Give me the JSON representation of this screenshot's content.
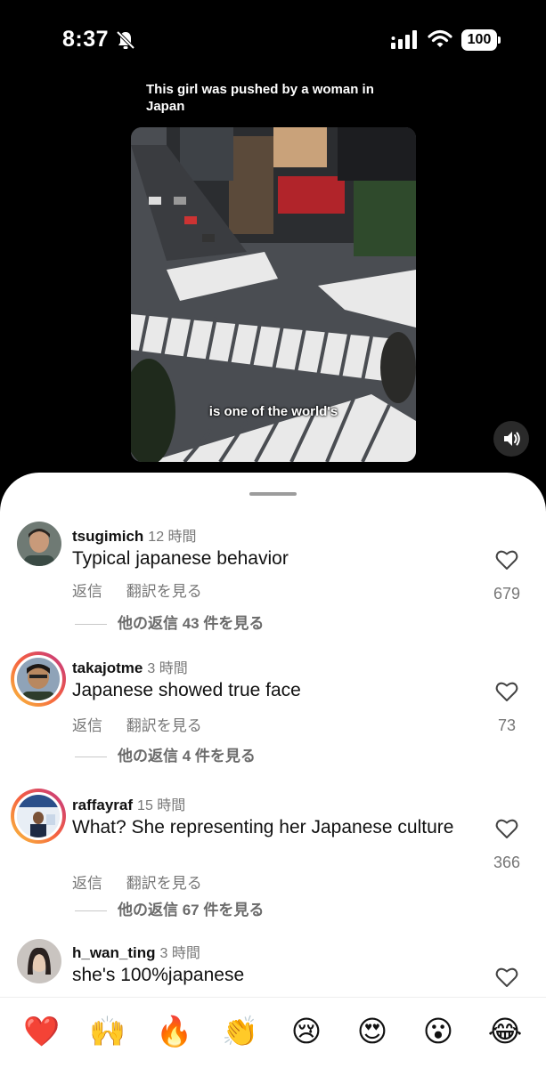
{
  "status_bar": {
    "time": "8:37",
    "battery": "100"
  },
  "post": {
    "caption": "This girl was pushed by a woman in Japan",
    "subtitle": "is one of the world's"
  },
  "comments": [
    {
      "username": "tsugimich",
      "time": "12 時間",
      "text": "Typical japanese behavior",
      "reply_label": "返信",
      "translate_label": "翻訳を見る",
      "more_replies": "他の返信 43 件を見る",
      "likes": "679"
    },
    {
      "username": "takajotme",
      "time": "3 時間",
      "text": "Japanese showed true face",
      "reply_label": "返信",
      "translate_label": "翻訳を見る",
      "more_replies": "他の返信 4 件を見る",
      "likes": "73"
    },
    {
      "username": "raffayraf",
      "time": "15 時間",
      "text": "What? She representing her Japanese culture",
      "reply_label": "返信",
      "translate_label": "翻訳を見る",
      "more_replies": "他の返信 67 件を見る",
      "likes": "366"
    },
    {
      "username": "h_wan_ting",
      "time": "3 時間",
      "text": "she's 100%japanese"
    }
  ],
  "emoji_bar": [
    "❤️",
    "🙌",
    "🔥",
    "👏",
    "😢",
    "😍",
    "😮",
    "😂"
  ],
  "icons": {
    "bell": "bell-slash-icon",
    "signal": "cellular-signal-icon",
    "wifi": "wifi-icon",
    "battery": "battery-icon",
    "sound": "speaker-icon",
    "heart": "heart-outline-icon"
  }
}
